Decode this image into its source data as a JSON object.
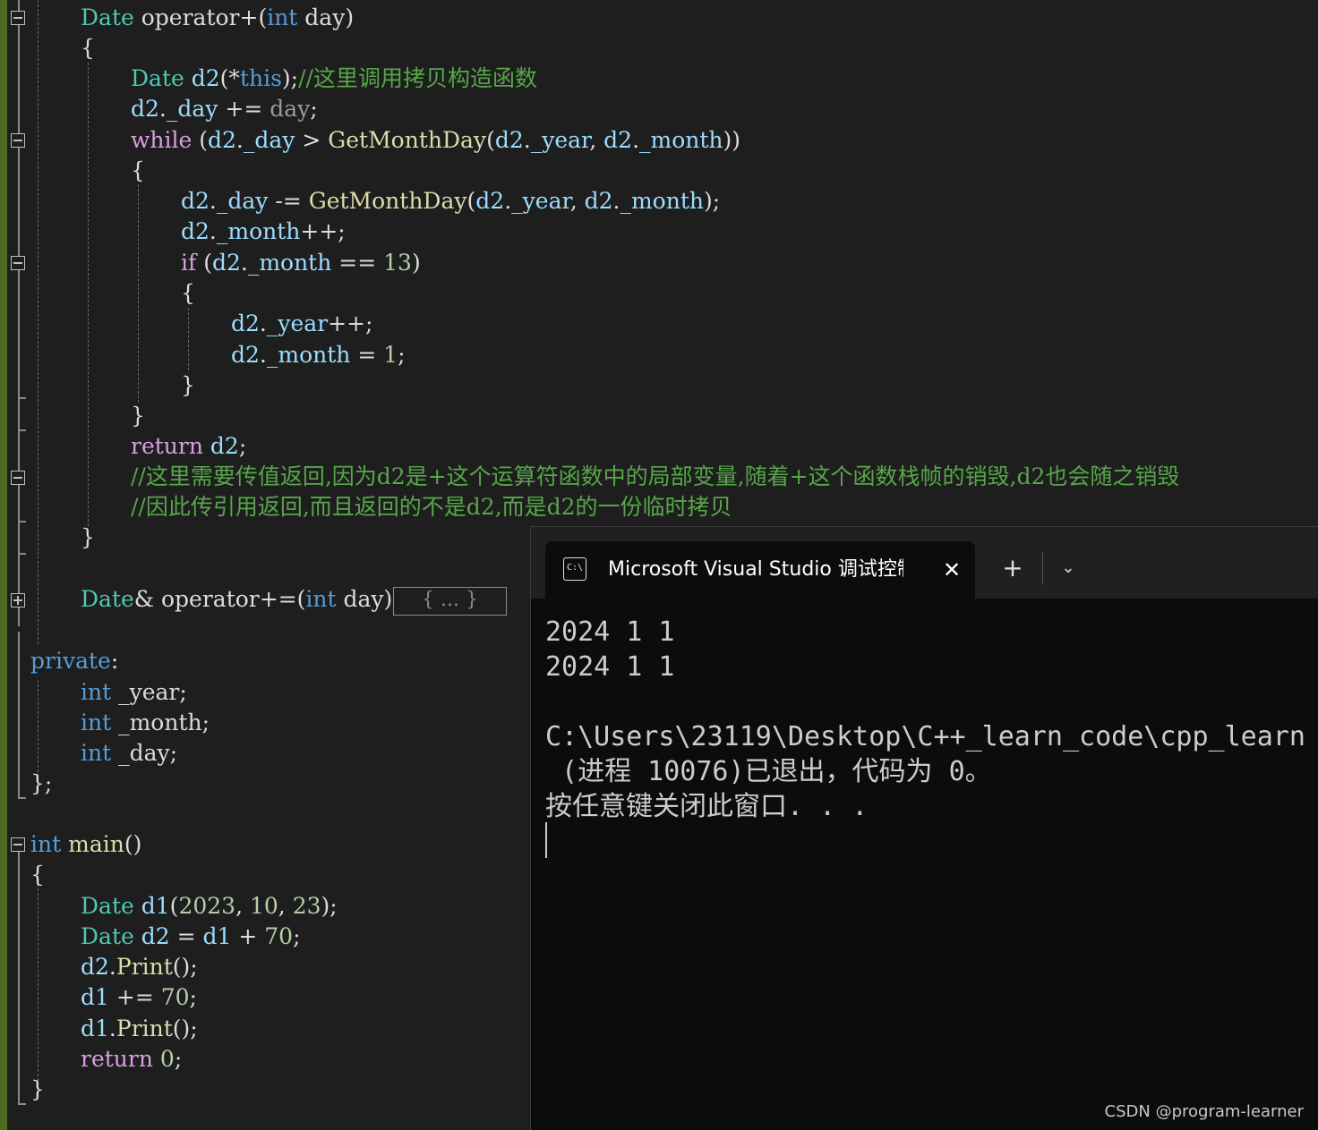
{
  "editor": {
    "code_lines": [
      [
        [
          "Date",
          "ty"
        ],
        [
          " operator+(",
          ""
        ],
        [
          "int",
          "kw"
        ],
        [
          " day",
          ""
        ],
        [
          ")",
          ""
        ]
      ],
      [
        [
          "{",
          ""
        ]
      ],
      [
        [
          "Date",
          "ty"
        ],
        [
          " ",
          ""
        ],
        [
          "d2",
          "vr"
        ],
        [
          "(*",
          ""
        ],
        [
          "this",
          "kw"
        ],
        [
          ");",
          ""
        ],
        [
          "//这里调用拷贝构造函数",
          "cm"
        ]
      ],
      [
        [
          "d2",
          "vr"
        ],
        [
          ".",
          ""
        ],
        [
          "_day",
          "vr"
        ],
        [
          " += ",
          ""
        ],
        [
          "day",
          "pm"
        ],
        [
          ";",
          ""
        ]
      ],
      [
        [
          "while",
          "ctl"
        ],
        [
          " (",
          ""
        ],
        [
          "d2",
          "vr"
        ],
        [
          ".",
          ""
        ],
        [
          "_day",
          "vr"
        ],
        [
          " > ",
          ""
        ],
        [
          "GetMonthDay",
          "fn"
        ],
        [
          "(",
          ""
        ],
        [
          "d2",
          "vr"
        ],
        [
          ".",
          ""
        ],
        [
          "_year",
          "vr"
        ],
        [
          ", ",
          ""
        ],
        [
          "d2",
          "vr"
        ],
        [
          ".",
          ""
        ],
        [
          "_month",
          "vr"
        ],
        [
          "))",
          ""
        ]
      ],
      [
        [
          "{",
          ""
        ]
      ],
      [
        [
          "d2",
          "vr"
        ],
        [
          ".",
          ""
        ],
        [
          "_day",
          "vr"
        ],
        [
          " -= ",
          ""
        ],
        [
          "GetMonthDay",
          "fn"
        ],
        [
          "(",
          ""
        ],
        [
          "d2",
          "vr"
        ],
        [
          ".",
          ""
        ],
        [
          "_year",
          "vr"
        ],
        [
          ", ",
          ""
        ],
        [
          "d2",
          "vr"
        ],
        [
          ".",
          ""
        ],
        [
          "_month",
          "vr"
        ],
        [
          ");",
          ""
        ]
      ],
      [
        [
          "d2",
          "vr"
        ],
        [
          ".",
          ""
        ],
        [
          "_month",
          "vr"
        ],
        [
          "++;",
          ""
        ]
      ],
      [
        [
          "if",
          "ctl"
        ],
        [
          " (",
          ""
        ],
        [
          "d2",
          "vr"
        ],
        [
          ".",
          ""
        ],
        [
          "_month",
          "vr"
        ],
        [
          " == ",
          ""
        ],
        [
          "13",
          "nm"
        ],
        [
          ")",
          ""
        ]
      ],
      [
        [
          "{",
          ""
        ]
      ],
      [
        [
          "d2",
          "vr"
        ],
        [
          ".",
          ""
        ],
        [
          "_year",
          "vr"
        ],
        [
          "++;",
          ""
        ]
      ],
      [
        [
          "d2",
          "vr"
        ],
        [
          ".",
          ""
        ],
        [
          "_month",
          "vr"
        ],
        [
          " = ",
          ""
        ],
        [
          "1",
          "nm"
        ],
        [
          ";",
          ""
        ]
      ],
      [
        [
          "}",
          ""
        ]
      ],
      [
        [
          "}",
          ""
        ]
      ],
      [
        [
          "return",
          "ctl"
        ],
        [
          " ",
          ""
        ],
        [
          "d2",
          "vr"
        ],
        [
          ";",
          ""
        ]
      ],
      [
        [
          "//这里需要传值返回,因为d2是+这个运算符函数中的局部变量,随着+这个函数栈帧的销毁,d2也会随之销毁",
          "cm"
        ]
      ],
      [
        [
          "//因此传引用返回,而且返回的不是d2,而是d2的一份临时拷贝",
          "cm"
        ]
      ],
      [
        [
          "}",
          ""
        ]
      ],
      [
        [
          "Date",
          "ty"
        ],
        [
          "& operator+=(",
          ""
        ],
        [
          "int",
          "kw"
        ],
        [
          " day",
          ""
        ],
        [
          ")",
          ""
        ]
      ],
      [
        [
          "private",
          "kw"
        ],
        [
          ":",
          ""
        ]
      ],
      [
        [
          "int",
          "kw"
        ],
        [
          " _year;",
          ""
        ]
      ],
      [
        [
          "int",
          "kw"
        ],
        [
          " _month;",
          ""
        ]
      ],
      [
        [
          "int",
          "kw"
        ],
        [
          " _day;",
          ""
        ]
      ],
      [
        [
          "};",
          ""
        ]
      ],
      [
        [
          "int",
          "kw"
        ],
        [
          " ",
          ""
        ],
        [
          "main",
          "fn"
        ],
        [
          "()",
          ""
        ]
      ],
      [
        [
          "{",
          ""
        ]
      ],
      [
        [
          "Date",
          "ty"
        ],
        [
          " ",
          ""
        ],
        [
          "d1",
          "vr"
        ],
        [
          "(",
          ""
        ],
        [
          "2023",
          "nm"
        ],
        [
          ", ",
          ""
        ],
        [
          "10",
          "nm"
        ],
        [
          ", ",
          ""
        ],
        [
          "23",
          "nm"
        ],
        [
          ");",
          ""
        ]
      ],
      [
        [
          "Date",
          "ty"
        ],
        [
          " ",
          ""
        ],
        [
          "d2",
          "vr"
        ],
        [
          " = ",
          ""
        ],
        [
          "d1",
          "vr"
        ],
        [
          " + ",
          ""
        ],
        [
          "70",
          "nm"
        ],
        [
          ";",
          ""
        ]
      ],
      [
        [
          "d2",
          "vr"
        ],
        [
          ".",
          ""
        ],
        [
          "Print",
          "fn"
        ],
        [
          "();",
          ""
        ]
      ],
      [
        [
          "d1",
          "vr"
        ],
        [
          " += ",
          ""
        ],
        [
          "70",
          "nm"
        ],
        [
          ";",
          ""
        ]
      ],
      [
        [
          "d1",
          "vr"
        ],
        [
          ".",
          ""
        ],
        [
          "Print",
          "fn"
        ],
        [
          "();",
          ""
        ]
      ],
      [
        [
          "return",
          "ctl"
        ],
        [
          " ",
          ""
        ],
        [
          "0",
          "nm"
        ],
        [
          ";",
          ""
        ]
      ],
      [
        [
          "}",
          ""
        ]
      ]
    ],
    "collapsed_placeholder": "{ ... }"
  },
  "terminal": {
    "tab_icon_text": "C:\\",
    "tab_title": "Microsoft Visual Studio 调试控制台",
    "close_symbol": "✕",
    "new_tab_symbol": "+",
    "dropdown_symbol": "⌄",
    "output_lines": [
      "2024 1 1",
      "2024 1 1",
      "",
      "C:\\Users\\23119\\Desktop\\C++_learn_code\\cpp_learn",
      " (进程 10076)已退出，代码为 0。",
      "按任意键关闭此窗口. . ."
    ]
  },
  "watermark": "CSDN @program-learner"
}
